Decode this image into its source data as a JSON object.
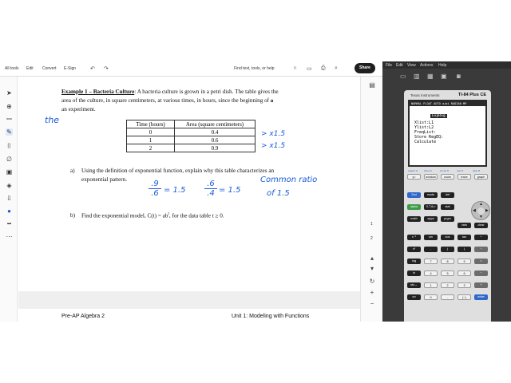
{
  "pdf_toolbar": {
    "all_tools": "All tools",
    "edit": "Edit",
    "convert": "Convert",
    "esign": "E-Sign",
    "find": "Find text, tools, or help",
    "share": "Share"
  },
  "document": {
    "title": "Example 1 – Bacteria Culture",
    "intro_line1": ": A bacteria culture is grown in a petri dish. The table gives the",
    "intro_line2": "area of the culture, in square centimeters, at various times, in hours, since the beginning of",
    "intro_strike": "a",
    "intro_line3": "an experiment.",
    "table": {
      "headers": [
        "Time (hours)",
        "Area (square centimeters)"
      ],
      "rows": [
        [
          "0",
          "0.4"
        ],
        [
          "1",
          "0.6"
        ],
        [
          "2",
          "0.9"
        ]
      ]
    },
    "part_a_label": "a)",
    "part_a_line1": "Using the definition of exponential function, explain why this table characterizes an",
    "part_a_line2": "exponential pattern.",
    "part_b_label": "b)",
    "part_b_text": "Find the exponential model, C(t) = ab",
    "part_b_sup": "t",
    "part_b_tail": ", for the data table t ≥ 0.",
    "footer_left": "Pre-AP Algebra 2",
    "footer_right": "Unit 1: Modeling with Functions"
  },
  "annotations": {
    "the": "the",
    "x15a": "> x1.5",
    "x15b": "> x1.5",
    "frac1_num": ".9",
    "frac1_den": ".6",
    "eq1": "= 1.5",
    "frac2_num": ".6",
    "frac2_den": ".4",
    "eq2": "= 1.5",
    "common1": "Common ratio",
    "common2": "of   1.5"
  },
  "page_rail": {
    "page_1": "1",
    "page_2": "2"
  },
  "calculator": {
    "menu": [
      "File",
      "Edit",
      "View",
      "Actions",
      "Help"
    ],
    "brand": "Texas Instruments",
    "model": "TI-84 Plus CE",
    "status": "NORMAL FLOAT AUTO a+bi RADIAN MP",
    "program": "ExpReg",
    "lines": [
      "Xlist:L1",
      "Ylist:L2",
      "FreqList:",
      "Store RegEQ:",
      "Calculate"
    ],
    "fkeys_sub": [
      "statplot f1",
      "tblset f2",
      "format f3",
      "calc f4",
      "table f5"
    ],
    "rows": [
      [
        "y=",
        "window",
        "zoom",
        "trace",
        "graph"
      ],
      [
        "2nd",
        "mode",
        "del"
      ],
      [
        "alpha",
        "X,T,θ,n",
        "stat"
      ],
      [
        "math",
        "apps",
        "prgm",
        "vars",
        "clear"
      ],
      [
        "x⁻¹",
        "sin",
        "cos",
        "tan",
        "^"
      ],
      [
        "x²",
        ",",
        "(",
        ")",
        "÷"
      ],
      [
        "log",
        "7",
        "8",
        "9",
        "×"
      ],
      [
        "ln",
        "4",
        "5",
        "6",
        "−"
      ],
      [
        "sto→",
        "1",
        "2",
        "3",
        "+"
      ],
      [
        "on",
        "0",
        ".",
        "(−)",
        "enter"
      ]
    ]
  },
  "colors": {
    "ink": "#1a5bd8",
    "calc_blue": "#2f68c9",
    "calc_green": "#3b9b48"
  }
}
